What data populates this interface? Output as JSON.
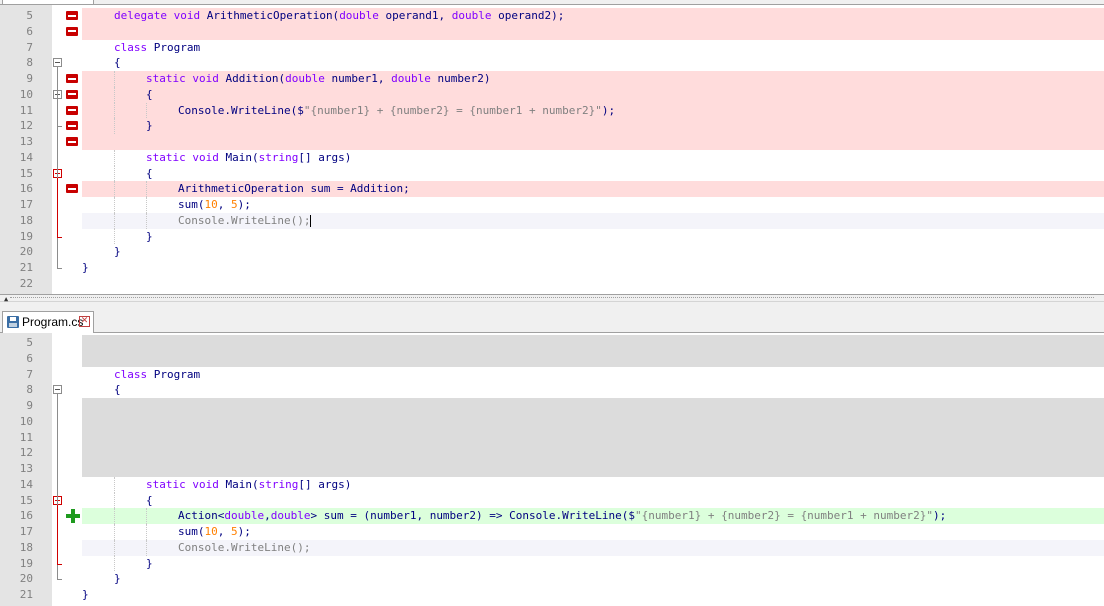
{
  "tab": {
    "label": "Program.cs",
    "save_icon": "save-icon",
    "close_icon": "close-icon"
  },
  "colors": {
    "deleted": "#ffdcdc",
    "added": "#dcffdc",
    "placeholder": "#dcdcdc",
    "change_marker": "#c80000",
    "add_marker": "#1e9a1e",
    "keyword": "#8000ff",
    "number": "#ff8000"
  },
  "top_pane": {
    "lines": [
      {
        "n": "5",
        "bg": "del",
        "marker": "minus",
        "fold": "",
        "indent": 1,
        "tokens": [
          [
            "kw",
            "delegate"
          ],
          [
            "id",
            " "
          ],
          [
            "kw",
            "void"
          ],
          [
            "id",
            " ArithmeticOperation("
          ],
          [
            "kw",
            "double"
          ],
          [
            "id",
            " operand1, "
          ],
          [
            "kw",
            "double"
          ],
          [
            "id",
            " operand2);"
          ]
        ]
      },
      {
        "n": "6",
        "bg": "del",
        "marker": "minus",
        "fold": "",
        "indent": 0,
        "tokens": []
      },
      {
        "n": "7",
        "bg": "",
        "marker": "",
        "fold": "",
        "indent": 1,
        "tokens": [
          [
            "kw",
            "class"
          ],
          [
            "id",
            " Program"
          ]
        ]
      },
      {
        "n": "8",
        "bg": "",
        "marker": "",
        "fold": "box",
        "indent": 1,
        "tokens": [
          [
            "id",
            "{"
          ]
        ]
      },
      {
        "n": "9",
        "bg": "del",
        "marker": "minus",
        "fold": "",
        "indent": 2,
        "tokens": [
          [
            "kw",
            "static"
          ],
          [
            "id",
            " "
          ],
          [
            "kw",
            "void"
          ],
          [
            "id",
            " Addition("
          ],
          [
            "kw",
            "double"
          ],
          [
            "id",
            " number1, "
          ],
          [
            "kw",
            "double"
          ],
          [
            "id",
            " number2)"
          ]
        ]
      },
      {
        "n": "10",
        "bg": "del",
        "marker": "minus",
        "fold": "box",
        "indent": 2,
        "tokens": [
          [
            "id",
            "{"
          ]
        ]
      },
      {
        "n": "11",
        "bg": "del",
        "marker": "minus",
        "fold": "",
        "indent": 3,
        "tokens": [
          [
            "id",
            "Console.WriteLine($"
          ],
          [
            "str",
            "\"{number1} + {number2} = {number1 + number2}\""
          ],
          [
            "id",
            ");"
          ]
        ]
      },
      {
        "n": "12",
        "bg": "del",
        "marker": "minus",
        "fold": "",
        "indent": 2,
        "tokens": [
          [
            "id",
            "}"
          ]
        ]
      },
      {
        "n": "13",
        "bg": "del",
        "marker": "minus",
        "fold": "",
        "indent": 0,
        "tokens": []
      },
      {
        "n": "14",
        "bg": "",
        "marker": "",
        "fold": "",
        "indent": 2,
        "tokens": [
          [
            "kw",
            "static"
          ],
          [
            "id",
            " "
          ],
          [
            "kw",
            "void"
          ],
          [
            "id",
            " Main("
          ],
          [
            "kw",
            "string"
          ],
          [
            "id",
            "[] args)"
          ]
        ]
      },
      {
        "n": "15",
        "bg": "",
        "marker": "",
        "fold": "redbox",
        "indent": 2,
        "tokens": [
          [
            "id",
            "{"
          ]
        ]
      },
      {
        "n": "16",
        "bg": "del",
        "marker": "minus",
        "fold": "",
        "indent": 3,
        "tokens": [
          [
            "id",
            "ArithmeticOperation sum = Addition;"
          ]
        ]
      },
      {
        "n": "17",
        "bg": "",
        "marker": "",
        "fold": "",
        "indent": 3,
        "tokens": [
          [
            "id",
            "sum("
          ],
          [
            "num",
            "10"
          ],
          [
            "id",
            ", "
          ],
          [
            "num",
            "5"
          ],
          [
            "id",
            ");"
          ]
        ]
      },
      {
        "n": "18",
        "bg": "cur",
        "marker": "",
        "fold": "",
        "indent": 3,
        "tokens": [
          [
            "str",
            "Console.WriteLine();"
          ]
        ]
      },
      {
        "n": "19",
        "bg": "",
        "marker": "",
        "fold": "",
        "indent": 2,
        "tokens": [
          [
            "id",
            "}"
          ]
        ]
      },
      {
        "n": "20",
        "bg": "",
        "marker": "",
        "fold": "",
        "indent": 1,
        "tokens": [
          [
            "id",
            "}"
          ]
        ]
      },
      {
        "n": "21",
        "bg": "",
        "marker": "",
        "fold": "",
        "indent": 0,
        "tokens": [
          [
            "id",
            "}"
          ]
        ]
      },
      {
        "n": "22",
        "bg": "",
        "marker": "",
        "fold": "",
        "indent": 0,
        "tokens": []
      }
    ]
  },
  "bottom_pane": {
    "lines": [
      {
        "n": "5",
        "bg": "gray",
        "marker": "",
        "fold": "",
        "indent": 0,
        "tokens": []
      },
      {
        "n": "6",
        "bg": "gray",
        "marker": "",
        "fold": "",
        "indent": 0,
        "tokens": []
      },
      {
        "n": "7",
        "bg": "",
        "marker": "",
        "fold": "",
        "indent": 1,
        "tokens": [
          [
            "kw",
            "class"
          ],
          [
            "id",
            " Program"
          ]
        ]
      },
      {
        "n": "8",
        "bg": "",
        "marker": "",
        "fold": "box",
        "indent": 1,
        "tokens": [
          [
            "id",
            "{"
          ]
        ]
      },
      {
        "n": "9",
        "bg": "gray",
        "marker": "",
        "fold": "",
        "indent": 0,
        "tokens": []
      },
      {
        "n": "10",
        "bg": "gray",
        "marker": "",
        "fold": "",
        "indent": 0,
        "tokens": []
      },
      {
        "n": "11",
        "bg": "gray",
        "marker": "",
        "fold": "",
        "indent": 0,
        "tokens": []
      },
      {
        "n": "12",
        "bg": "gray",
        "marker": "",
        "fold": "",
        "indent": 0,
        "tokens": []
      },
      {
        "n": "13",
        "bg": "gray",
        "marker": "",
        "fold": "",
        "indent": 0,
        "tokens": []
      },
      {
        "n": "14",
        "bg": "",
        "marker": "",
        "fold": "",
        "indent": 2,
        "tokens": [
          [
            "kw",
            "static"
          ],
          [
            "id",
            " "
          ],
          [
            "kw",
            "void"
          ],
          [
            "id",
            " Main("
          ],
          [
            "kw",
            "string"
          ],
          [
            "id",
            "[] args)"
          ]
        ]
      },
      {
        "n": "15",
        "bg": "",
        "marker": "",
        "fold": "redbox",
        "indent": 2,
        "tokens": [
          [
            "id",
            "{"
          ]
        ]
      },
      {
        "n": "16",
        "bg": "add",
        "marker": "plus",
        "fold": "",
        "indent": 3,
        "tokens": [
          [
            "id",
            "Action<"
          ],
          [
            "kw",
            "double"
          ],
          [
            "id",
            ","
          ],
          [
            "kw",
            "double"
          ],
          [
            "id",
            "> sum = (number1, number2) => Console.WriteLine($"
          ],
          [
            "str",
            "\"{number1} + {number2} = {number1 + number2}\""
          ],
          [
            "id",
            ");"
          ]
        ]
      },
      {
        "n": "17",
        "bg": "",
        "marker": "",
        "fold": "",
        "indent": 3,
        "tokens": [
          [
            "id",
            "sum("
          ],
          [
            "num",
            "10"
          ],
          [
            "id",
            ", "
          ],
          [
            "num",
            "5"
          ],
          [
            "id",
            ");"
          ]
        ]
      },
      {
        "n": "18",
        "bg": "cur",
        "marker": "",
        "fold": "",
        "indent": 3,
        "tokens": [
          [
            "str",
            "Console.WriteLine();"
          ]
        ]
      },
      {
        "n": "19",
        "bg": "",
        "marker": "",
        "fold": "",
        "indent": 2,
        "tokens": [
          [
            "id",
            "}"
          ]
        ]
      },
      {
        "n": "20",
        "bg": "",
        "marker": "",
        "fold": "",
        "indent": 1,
        "tokens": [
          [
            "id",
            "}"
          ]
        ]
      },
      {
        "n": "21",
        "bg": "",
        "marker": "",
        "fold": "",
        "indent": 0,
        "tokens": [
          [
            "id",
            "}"
          ]
        ]
      }
    ]
  }
}
